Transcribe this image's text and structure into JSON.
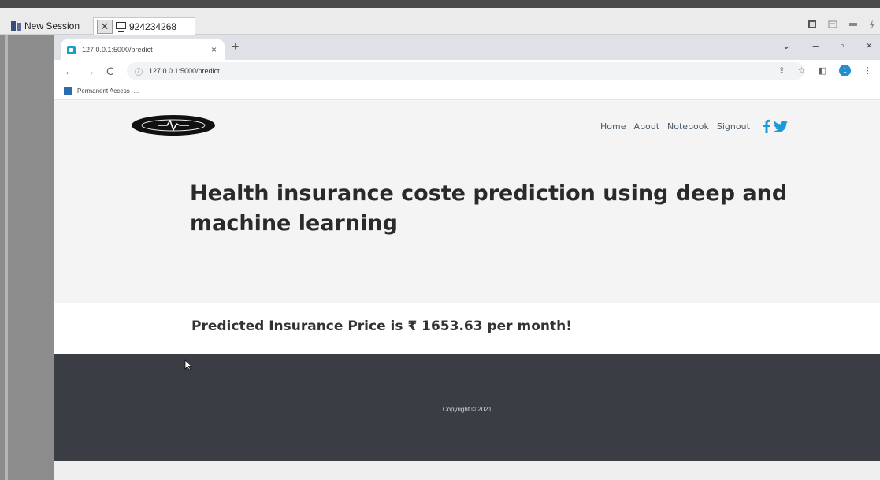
{
  "session": {
    "tab1_label": "New Session",
    "tab2_label": "924234268"
  },
  "browser": {
    "tab_title": "127.0.0.1:5000/predict",
    "url": "127.0.0.1:5000/predict",
    "bookmark_label": "Permanent Access -...",
    "profile_initial": "1"
  },
  "site": {
    "nav": {
      "home": "Home",
      "about": "About",
      "notebook": "Notebook",
      "signout": "Signout"
    },
    "title": "Health insurance coste prediction using deep and machine learning",
    "prediction_text": "Predicted Insurance Price is ₹ 1653.63 per month!",
    "copyright": "Copyright © 2021"
  },
  "colors": {
    "social_blue": "#1a9bd7",
    "footer_bg": "#3a3e44"
  }
}
